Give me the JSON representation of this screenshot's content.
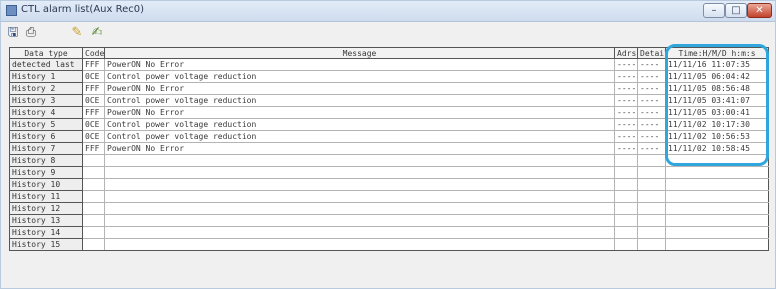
{
  "window": {
    "title": "CTL alarm list(Aux Rec0)",
    "minimize_label": "–",
    "maximize_label": "□",
    "close_label": "✕"
  },
  "toolbar": {
    "icons": [
      "save-icon",
      "print-icon",
      "pencil-icon",
      "edit-icon"
    ]
  },
  "table": {
    "headers": {
      "type": "Data type",
      "code": "Code",
      "message": "Message",
      "adrs": "Adrs",
      "detail": "Detail",
      "time": "Time:H/M/D h:m:s"
    },
    "rows": [
      {
        "type": "detected last",
        "code": "FFF",
        "message": "PowerON No Error",
        "adrs": "----",
        "detail": "----",
        "time": "11/11/16 11:07:35"
      },
      {
        "type": "History 1",
        "code": "0CE",
        "message": "Control power voltage reduction",
        "adrs": "----",
        "detail": "----",
        "time": "11/11/05 06:04:42"
      },
      {
        "type": "History 2",
        "code": "FFF",
        "message": "PowerON No Error",
        "adrs": "----",
        "detail": "----",
        "time": "11/11/05 08:56:48"
      },
      {
        "type": "History 3",
        "code": "0CE",
        "message": "Control power voltage reduction",
        "adrs": "----",
        "detail": "----",
        "time": "11/11/05 03:41:07"
      },
      {
        "type": "History 4",
        "code": "FFF",
        "message": "PowerON No Error",
        "adrs": "----",
        "detail": "----",
        "time": "11/11/05 03:00:41"
      },
      {
        "type": "History 5",
        "code": "0CE",
        "message": "Control power voltage reduction",
        "adrs": "----",
        "detail": "----",
        "time": "11/11/02 10:17:30"
      },
      {
        "type": "History 6",
        "code": "0CE",
        "message": "Control power voltage reduction",
        "adrs": "----",
        "detail": "----",
        "time": "11/11/02 10:56:53"
      },
      {
        "type": "History 7",
        "code": "FFF",
        "message": "PowerON No Error",
        "adrs": "----",
        "detail": "----",
        "time": "11/11/02 10:58:45"
      },
      {
        "type": "History 8",
        "code": "",
        "message": "",
        "adrs": "",
        "detail": "",
        "time": ""
      },
      {
        "type": "History 9",
        "code": "",
        "message": "",
        "adrs": "",
        "detail": "",
        "time": ""
      },
      {
        "type": "History 10",
        "code": "",
        "message": "",
        "adrs": "",
        "detail": "",
        "time": ""
      },
      {
        "type": "History 11",
        "code": "",
        "message": "",
        "adrs": "",
        "detail": "",
        "time": ""
      },
      {
        "type": "History 12",
        "code": "",
        "message": "",
        "adrs": "",
        "detail": "",
        "time": ""
      },
      {
        "type": "History 13",
        "code": "",
        "message": "",
        "adrs": "",
        "detail": "",
        "time": ""
      },
      {
        "type": "History 14",
        "code": "",
        "message": "",
        "adrs": "",
        "detail": "",
        "time": ""
      },
      {
        "type": "History 15",
        "code": "",
        "message": "",
        "adrs": "",
        "detail": "",
        "time": ""
      }
    ]
  },
  "colors": {
    "highlight": "#2fa6dc",
    "titlebar": "#d6e2f2",
    "close_button": "#c2422b"
  }
}
